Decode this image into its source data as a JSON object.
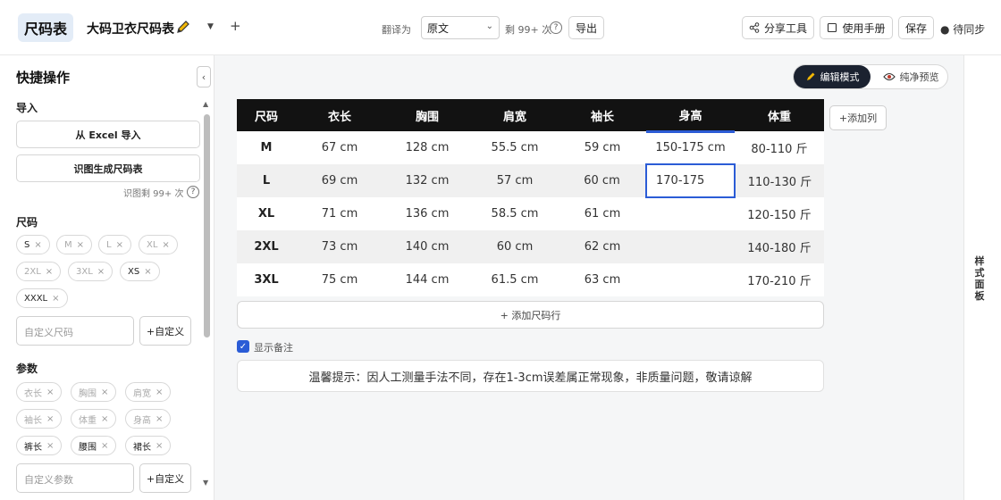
{
  "header": {
    "logo": "尺码表",
    "doc_title": "大码卫衣尺码表",
    "translate_label": "翻译为",
    "language_selected": "原文",
    "remain_text": "剩 99+ 次",
    "export_label": "导出",
    "share_label": "分享工具",
    "manual_label": "使用手册",
    "save_label": "保存",
    "sync_status": "待同步"
  },
  "sidebar": {
    "title": "快捷操作",
    "collapse_glyph": "‹",
    "import_heading": "导入",
    "excel_import": "从 Excel 导入",
    "ocr_generate": "识图生成尺码表",
    "ocr_remain": "识图剩 99+ 次",
    "size_heading": "尺码",
    "sizes": [
      {
        "label": "S",
        "active": true
      },
      {
        "label": "M",
        "active": false
      },
      {
        "label": "L",
        "active": false
      },
      {
        "label": "XL",
        "active": false
      },
      {
        "label": "2XL",
        "active": false
      },
      {
        "label": "3XL",
        "active": false
      },
      {
        "label": "XS",
        "active": true
      },
      {
        "label": "XXXL",
        "active": true
      }
    ],
    "custom_size_placeholder": "自定义尺码",
    "custom_btn": "+自定义",
    "param_heading": "参数",
    "params": [
      {
        "label": "衣长",
        "active": false
      },
      {
        "label": "胸围",
        "active": false
      },
      {
        "label": "肩宽",
        "active": false
      },
      {
        "label": "袖长",
        "active": false
      },
      {
        "label": "体重",
        "active": false
      },
      {
        "label": "身高",
        "active": false
      },
      {
        "label": "裤长",
        "active": true
      },
      {
        "label": "腰围",
        "active": true
      },
      {
        "label": "裙长",
        "active": true
      }
    ],
    "custom_param_placeholder": "自定义参数",
    "custom_param_btn": "+自定义"
  },
  "mode": {
    "edit_label": "编辑模式",
    "preview_label": "纯净预览"
  },
  "table": {
    "headers": [
      "尺码",
      "衣长",
      "胸围",
      "肩宽",
      "袖长",
      "身高",
      "体重"
    ],
    "rows": [
      [
        "M",
        "67 cm",
        "128 cm",
        "55.5 cm",
        "59 cm",
        "150-175 cm",
        "80-110 斤"
      ],
      [
        "L",
        "69 cm",
        "132 cm",
        "57 cm",
        "60 cm",
        "170-175",
        "110-130 斤"
      ],
      [
        "XL",
        "71 cm",
        "136 cm",
        "58.5 cm",
        "61 cm",
        "",
        "120-150 斤"
      ],
      [
        "2XL",
        "73 cm",
        "140 cm",
        "60 cm",
        "62 cm",
        "",
        "140-180 斤"
      ],
      [
        "3XL",
        "75 cm",
        "144 cm",
        "61.5 cm",
        "63 cm",
        "",
        "170-210 斤"
      ]
    ],
    "add_col_label": "+添加列",
    "add_row_label": "+ 添加尺码行"
  },
  "note": {
    "show_label": "显示备注",
    "text": "温馨提示：因人工测量手法不同，存在1-3cm误差属正常现象，非质量问题，敬请谅解"
  },
  "right_panel": {
    "label": "样式面板"
  }
}
